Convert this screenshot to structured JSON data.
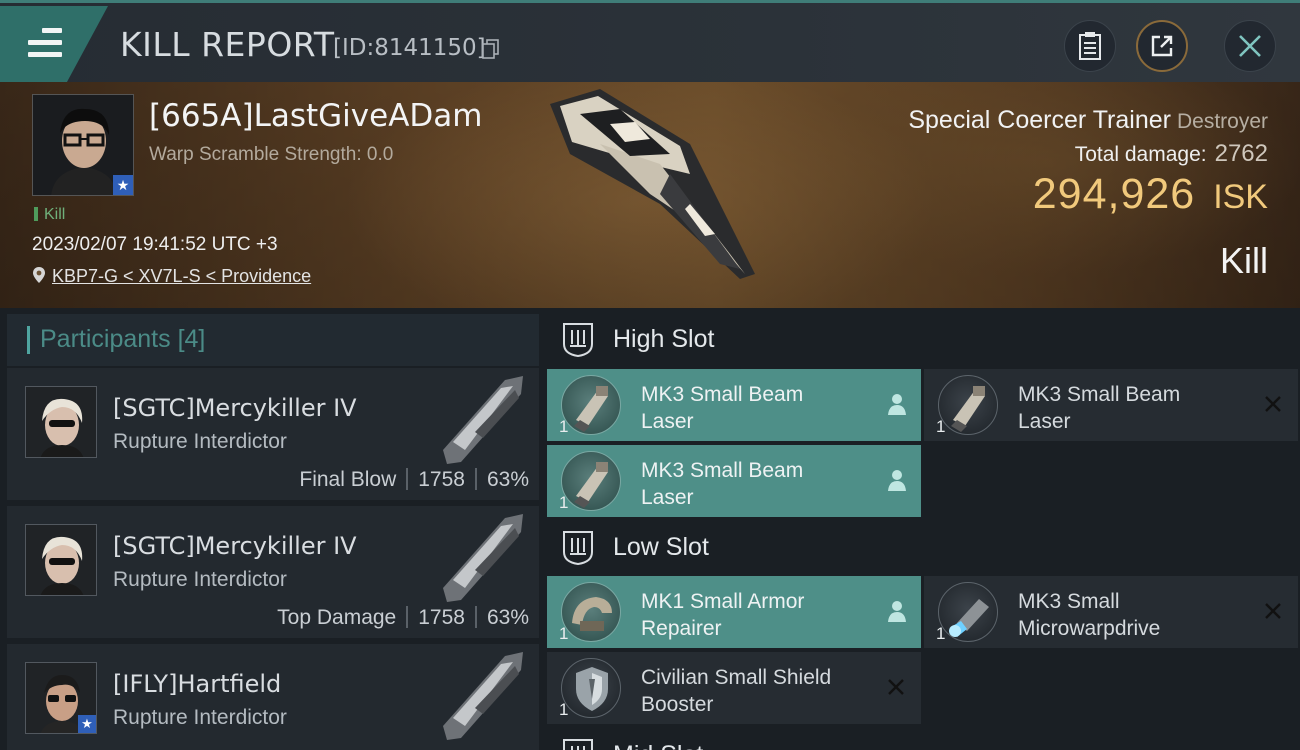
{
  "header": {
    "title": "KILL REPORT",
    "report_id": "[ID:8141150]"
  },
  "victim": {
    "name": "[665A]LastGiveADam",
    "warp_scramble": "Warp Scramble Strength: 0.0",
    "kill_tag": "Kill",
    "timestamp": "2023/02/07 19:41:52 UTC +3",
    "location": "KBP7-G < XV7L-S < Providence",
    "ship_name": "Special Coercer Trainer",
    "ship_class": "Destroyer",
    "total_damage_label": "Total damage:",
    "total_damage": "2762",
    "isk_value": "294,926",
    "isk_unit": "ISK",
    "result": "Kill"
  },
  "participants": {
    "label": "Participants",
    "count": "[4]",
    "items": [
      {
        "name": "[SGTC]Mercykiller IV",
        "ship": "Rupture Interdictor",
        "role": "Final Blow",
        "damage": "1758",
        "percent": "63%"
      },
      {
        "name": "[SGTC]Mercykiller IV",
        "ship": "Rupture Interdictor",
        "role": "Top Damage",
        "damage": "1758",
        "percent": "63%"
      },
      {
        "name": "[IFLY]Hartfield",
        "ship": "Rupture Interdictor"
      }
    ]
  },
  "slots": {
    "high": {
      "label": "High Slot",
      "items": [
        {
          "name": "MK3 Small Beam Laser",
          "qty": "1"
        },
        {
          "name": "MK3 Small Beam Laser",
          "qty": "1"
        },
        {
          "name": "MK3 Small Beam Laser",
          "qty": "1"
        }
      ]
    },
    "low": {
      "label": "Low Slot",
      "items": [
        {
          "name": "MK1 Small Armor Repairer",
          "qty": "1"
        },
        {
          "name": "MK3 Small Microwarpdrive",
          "qty": "1"
        },
        {
          "name": "Civilian Small Shield Booster",
          "qty": "1"
        }
      ]
    },
    "mid": {
      "label": "Mid Slot"
    }
  },
  "colors": {
    "accent": "#4e8f88",
    "isk": "#f1c97c",
    "kill_green": "#4f9c5c"
  }
}
